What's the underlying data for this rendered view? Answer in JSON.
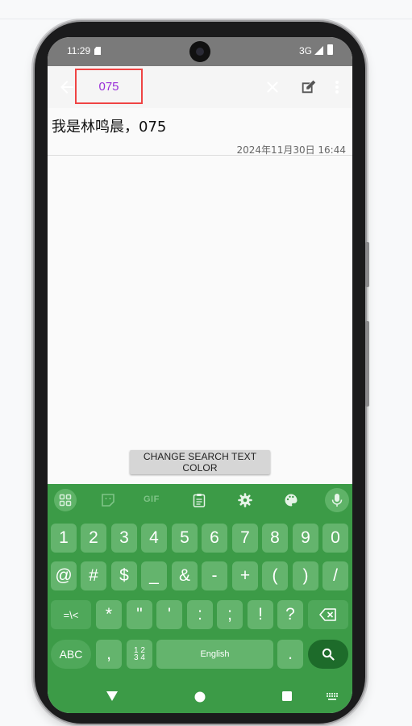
{
  "status_bar": {
    "time": "11:29",
    "network": "3G"
  },
  "toolbar": {
    "search_value": "075"
  },
  "note": {
    "body": "我是林鸣晨，075",
    "timestamp": "2024年11月30日 16:44"
  },
  "action_button": {
    "label": "CHANGE SEARCH TEXT COLOR"
  },
  "keyboard": {
    "toolbar": {
      "gif_label": "GIF"
    },
    "row1": [
      "1",
      "2",
      "3",
      "4",
      "5",
      "6",
      "7",
      "8",
      "9",
      "0"
    ],
    "row2": [
      "@",
      "#",
      "$",
      "_",
      "&",
      "-",
      "+",
      "(",
      ")",
      "/"
    ],
    "row3": {
      "mode": "=\\<",
      "keys": [
        "*",
        "\"",
        "'",
        ":",
        ";",
        "!",
        "?"
      ]
    },
    "row4": {
      "abc": "ABC",
      "comma": ",",
      "num_top": "1 2",
      "num_bottom": "3 4",
      "space": "English",
      "period": "."
    }
  },
  "colors": {
    "accent": "#9b30d9",
    "highlight_border": "#ef4444",
    "keyboard_bg": "#3c9b47"
  },
  "icons": [
    "back-arrow-icon",
    "close-icon",
    "edit-icon",
    "more-vert-icon",
    "apps-grid-icon",
    "sticker-icon",
    "clipboard-icon",
    "settings-icon",
    "palette-icon",
    "mic-icon",
    "backspace-icon",
    "search-icon",
    "nav-back-icon",
    "nav-home-icon",
    "nav-recents-icon",
    "keyboard-switch-icon"
  ]
}
